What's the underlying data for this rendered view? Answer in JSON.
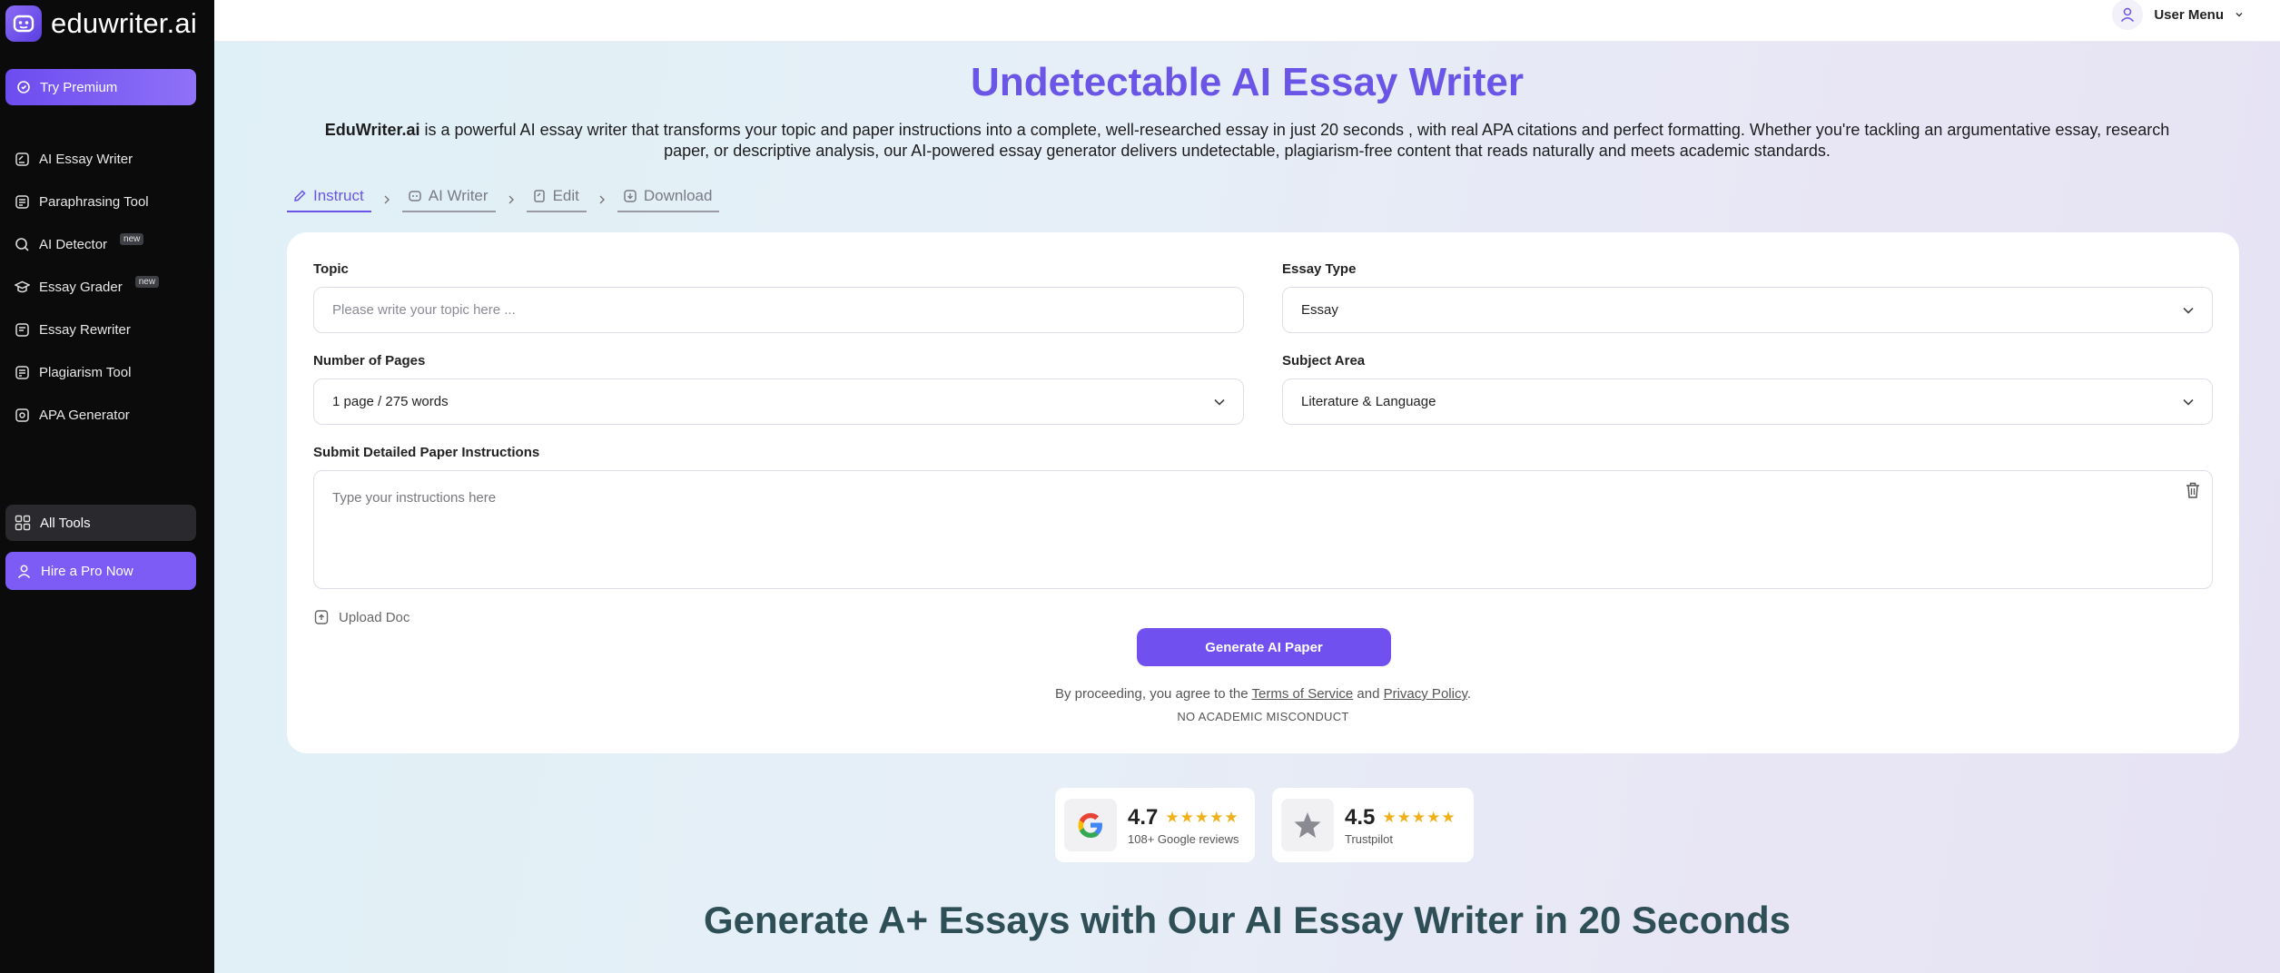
{
  "brand": {
    "name": "eduwriter.ai"
  },
  "sidebar": {
    "premium_label": "Try Premium",
    "items": [
      {
        "label": "AI Essay Writer",
        "badge": ""
      },
      {
        "label": "Paraphrasing Tool",
        "badge": ""
      },
      {
        "label": "AI Detector",
        "badge": "new"
      },
      {
        "label": "Essay Grader",
        "badge": "new"
      },
      {
        "label": "Essay Rewriter",
        "badge": ""
      },
      {
        "label": "Plagiarism Tool",
        "badge": ""
      },
      {
        "label": "APA Generator",
        "badge": ""
      }
    ],
    "all_tools_label": "All Tools",
    "hire_label": "Hire a Pro Now"
  },
  "header": {
    "user_menu_label": "User Menu"
  },
  "main": {
    "title": "Undetectable AI Essay Writer",
    "intro_brand": "EduWriter.ai",
    "intro_text": " is a powerful AI essay writer that transforms your topic and paper instructions into a complete, well-researched essay in just 20 seconds , with real APA citations and perfect formatting. Whether you're tackling an argumentative essay, research paper, or descriptive analysis, our AI-powered essay generator delivers undetectable, plagiarism-free content that reads naturally and meets academic standards.",
    "steps": [
      "Instruct",
      "AI Writer",
      "Edit",
      "Download"
    ],
    "active_step": "Instruct"
  },
  "form": {
    "topic_label": "Topic",
    "topic_placeholder": "Please write your topic here ...",
    "essay_type_label": "Essay Type",
    "essay_type_value": "Essay",
    "pages_label": "Number of Pages",
    "pages_value": "1 page / 275 words",
    "subject_label": "Subject Area",
    "subject_value": "Literature & Language",
    "instructions_label": "Submit Detailed Paper Instructions",
    "instructions_placeholder": "Type your instructions here",
    "upload_label": "Upload Doc",
    "generate_label": "Generate AI Paper",
    "legal_prefix": "By proceeding, you agree to the ",
    "terms_label": "Terms of Service",
    "legal_and": " and ",
    "privacy_label": "Privacy Policy",
    "legal_suffix": ".",
    "misconduct": "NO ACADEMIC MISCONDUCT"
  },
  "reviews": [
    {
      "score": "4.7",
      "stars": "★★★★★",
      "source": "108+ Google reviews",
      "icon": "google-icon"
    },
    {
      "score": "4.5",
      "stars": "★★★★★",
      "source": "Trustpilot",
      "icon": "trustpilot-star-icon"
    }
  ],
  "headline": "Generate A+ Essays with Our AI Essay Writer in 20 Seconds",
  "colors": {
    "accent": "#6b55e6",
    "button": "#7050ee",
    "sidebar_bg": "#0b0b0c",
    "star": "#f0b01c"
  }
}
